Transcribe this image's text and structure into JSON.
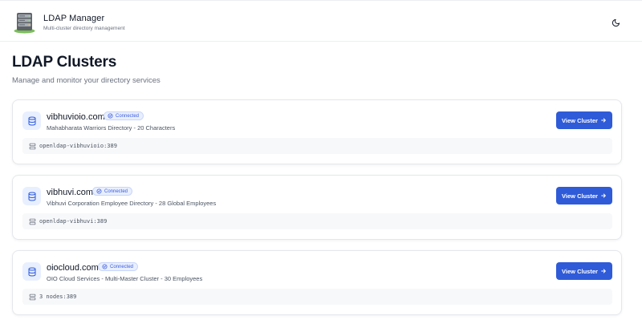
{
  "header": {
    "title": "LDAP Manager",
    "subtitle": "Multi-cluster directory management"
  },
  "page": {
    "title": "LDAP Clusters",
    "subtitle": "Manage and monitor your directory services"
  },
  "clusters": [
    {
      "domain": "vibhuvioio.com",
      "status": "Connected",
      "description": "Mahabharata Warriors Directory - 20 Characters",
      "host": "openldap-vibhuvioio:389",
      "action_label": "View Cluster"
    },
    {
      "domain": "vibhuvi.com",
      "status": "Connected",
      "description": "Vibhuvi Corporation Employee Directory - 28 Global Employees",
      "host": "openldap-vibhuvi:389",
      "action_label": "View Cluster"
    },
    {
      "domain": "oiocloud.com",
      "status": "Connected",
      "description": "OIO Cloud Services - Multi-Master Cluster - 30 Employees",
      "host": "3 nodes:389",
      "action_label": "View Cluster"
    }
  ],
  "icons": {
    "logo": "server-rack-logo",
    "theme": "moon-icon",
    "cluster": "database-icon",
    "status": "check-circle-icon",
    "action": "arrow-right-icon",
    "host": "server-icon"
  },
  "colors": {
    "accent": "#2f5bd8",
    "badge_bg": "#e8efff",
    "badge_text": "#3b5bdb"
  }
}
